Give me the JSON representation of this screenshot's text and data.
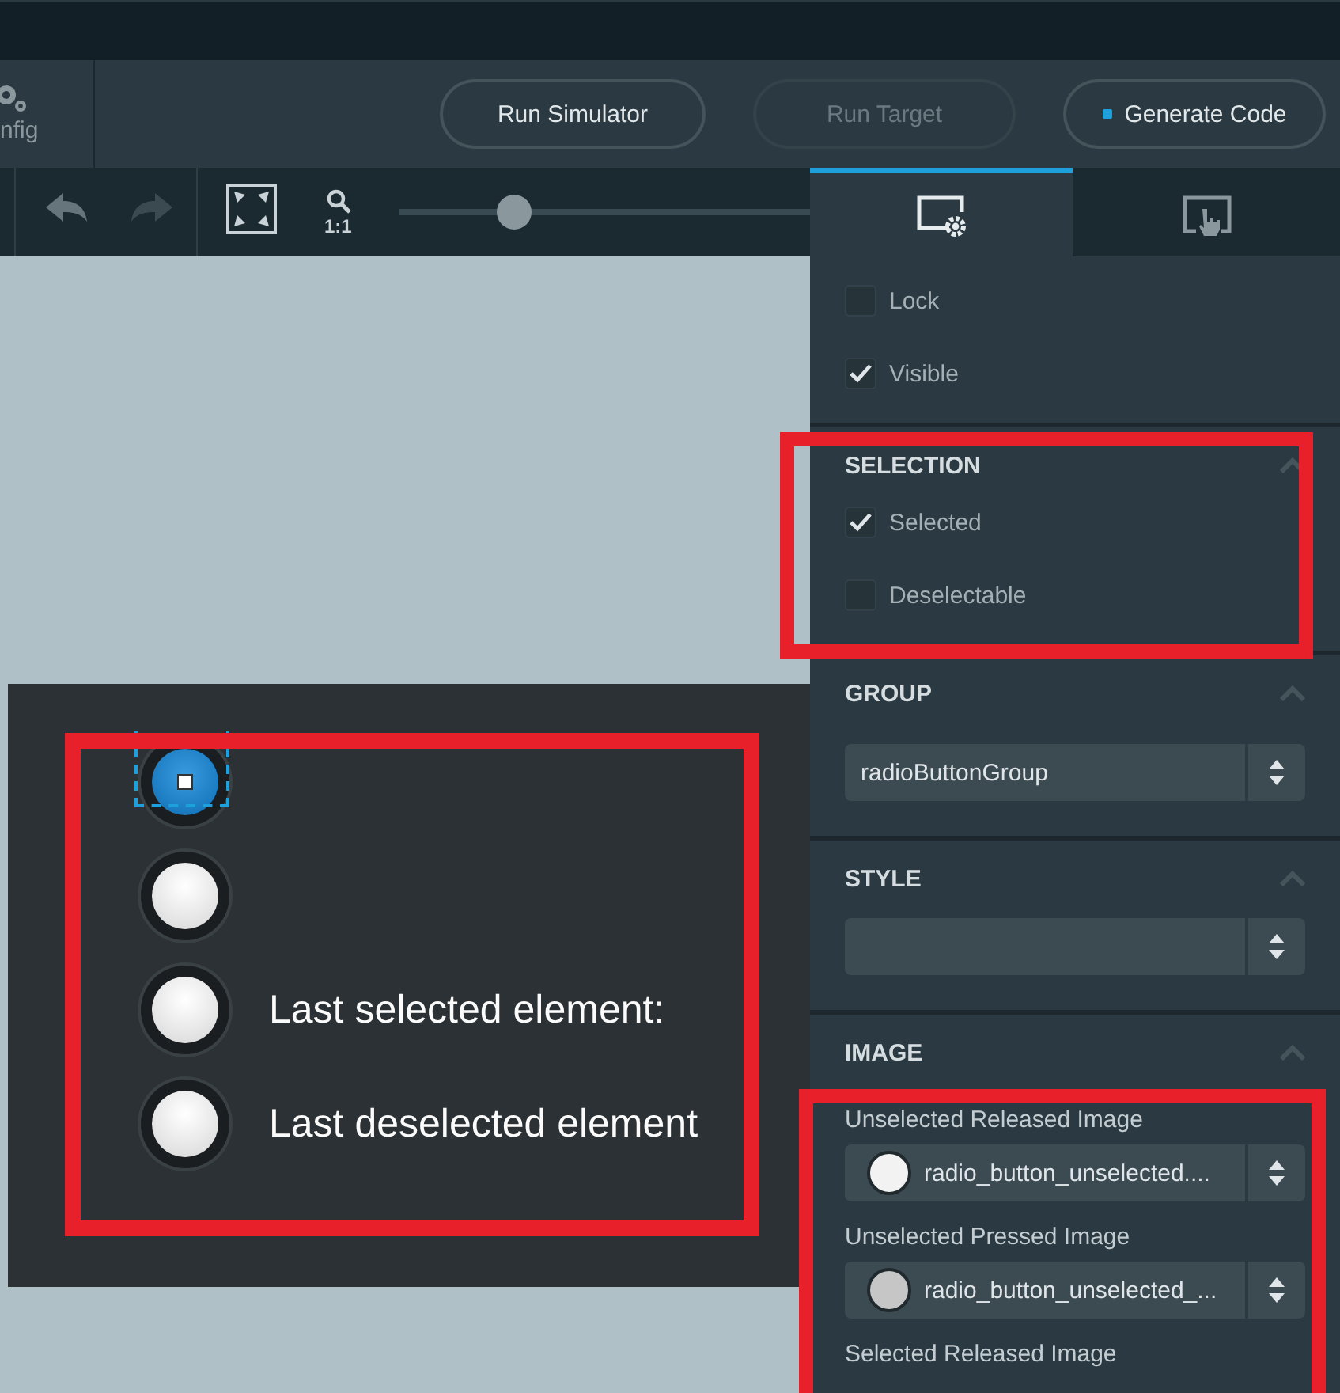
{
  "toolbar": {
    "config_label": "nfig",
    "buttons": [
      {
        "label": "Run Simulator",
        "disabled": false,
        "kind": "plain"
      },
      {
        "label": "Run Target",
        "disabled": true,
        "kind": "plain"
      },
      {
        "label": "Generate Code",
        "disabled": false,
        "kind": "dot"
      }
    ]
  },
  "canvas_toolbar": {
    "zoom_label": "1:1",
    "zoom": {
      "level": 0.25
    }
  },
  "panel": {
    "tabs": [
      {
        "kind": "properties",
        "selected": true
      },
      {
        "kind": "interactions",
        "selected": false
      }
    ],
    "general": [
      {
        "label": "Lock",
        "checked": false
      },
      {
        "label": "Visible",
        "checked": true
      }
    ],
    "sections": [
      {
        "title": "SELECTION",
        "kind": "checkboxes",
        "expanded": true,
        "items": [
          {
            "label": "Selected",
            "checked": true
          },
          {
            "label": "Deselectable",
            "checked": false
          }
        ]
      },
      {
        "title": "GROUP",
        "kind": "select",
        "expanded": true,
        "value": "radioButtonGroup"
      },
      {
        "title": "STYLE",
        "kind": "select",
        "expanded": true
      },
      {
        "title": "IMAGE",
        "kind": "images",
        "expanded": true,
        "items": [
          {
            "label": "Unselected Released Image",
            "value": "radio_button_unselected....",
            "color": "#f2f2f2"
          },
          {
            "label": "Unselected Pressed Image",
            "value": "radio_button_unselected_...",
            "color": "#c6c6c6"
          },
          {
            "label": "Selected Released Image"
          }
        ]
      }
    ]
  },
  "preview": {
    "radio_buttons": [
      {
        "selected": true,
        "focused": true
      },
      {
        "selected": false,
        "focused": false
      },
      {
        "selected": false,
        "focused": false,
        "label": "Last selected element:"
      },
      {
        "selected": false,
        "focused": false,
        "label": "Last deselected element"
      }
    ]
  }
}
